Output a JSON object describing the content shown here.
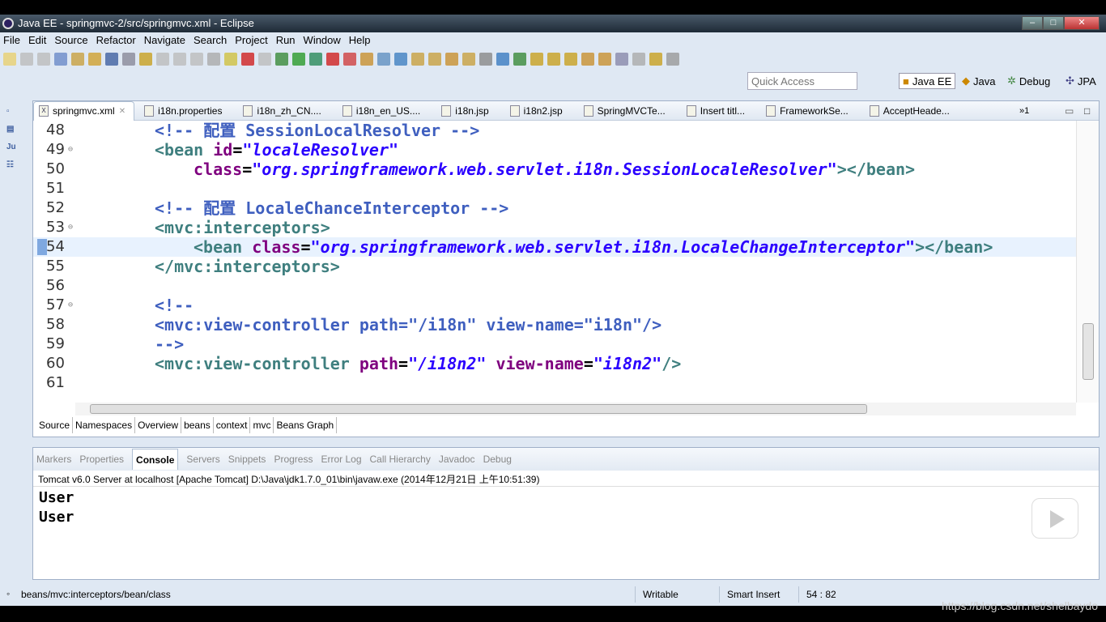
{
  "window": {
    "title": "Java EE - springmvc-2/src/springmvc.xml - Eclipse",
    "min": "–",
    "max": "□",
    "close": "✕"
  },
  "menu": [
    "File",
    "Edit",
    "Source",
    "Refactor",
    "Navigate",
    "Search",
    "Project",
    "Run",
    "Window",
    "Help"
  ],
  "quick_access": {
    "placeholder": "Quick Access"
  },
  "perspectives": [
    "Java EE",
    "Java",
    "Debug",
    "JPA"
  ],
  "left_icons": [
    "restore",
    "package",
    "Ju",
    "outline"
  ],
  "editor_tabs": [
    {
      "label": "springmvc.xml",
      "active": true,
      "icon": "X"
    },
    {
      "label": "i18n.properties"
    },
    {
      "label": "i18n_zh_CN...."
    },
    {
      "label": "i18n_en_US...."
    },
    {
      "label": "i18n.jsp"
    },
    {
      "label": "i18n2.jsp"
    },
    {
      "label": "SpringMVCTe..."
    },
    {
      "label": "Insert titl..."
    },
    {
      "label": "FrameworkSe..."
    },
    {
      "label": "AcceptHeade..."
    }
  ],
  "overflow_tabs": "»1",
  "code": [
    {
      "n": "48",
      "seg": [
        [
          "c",
          "<!-- 配置 SessionLocalResolver -->"
        ]
      ],
      "indent": 4
    },
    {
      "n": "49",
      "fold": true,
      "seg": [
        [
          "t",
          "<bean "
        ],
        [
          "a",
          "id"
        ],
        [
          "p",
          "="
        ],
        [
          "v",
          "\"localeResolver\""
        ]
      ],
      "indent": 4
    },
    {
      "n": "50",
      "seg": [
        [
          "a",
          "class"
        ],
        [
          "p",
          "="
        ],
        [
          "v",
          "\"org.springframework.web.servlet.i18n.SessionLocaleResolver\""
        ],
        [
          "t",
          "></bean>"
        ]
      ],
      "indent": 8
    },
    {
      "n": "51",
      "seg": [],
      "indent": 0
    },
    {
      "n": "52",
      "seg": [
        [
          "c",
          "<!-- 配置 LocaleChanceInterceptor -->"
        ]
      ],
      "indent": 4
    },
    {
      "n": "53",
      "fold": true,
      "seg": [
        [
          "t",
          "<mvc:interceptors>"
        ]
      ],
      "indent": 4
    },
    {
      "n": "54",
      "current": true,
      "seg": [
        [
          "t",
          "<bean "
        ],
        [
          "a",
          "class"
        ],
        [
          "p",
          "="
        ],
        [
          "v",
          "\"org.springframework.web.servlet.i18n.LocaleChangeInterceptor\""
        ],
        [
          "t",
          "></bean>"
        ]
      ],
      "indent": 8
    },
    {
      "n": "55",
      "seg": [
        [
          "t",
          "</mvc:interceptors>"
        ]
      ],
      "indent": 4
    },
    {
      "n": "56",
      "seg": [],
      "indent": 0
    },
    {
      "n": "57",
      "fold": true,
      "seg": [
        [
          "c",
          "<!--"
        ]
      ],
      "indent": 4
    },
    {
      "n": "58",
      "seg": [
        [
          "c",
          "<mvc:view-controller path=\"/i18n\" view-name=\"i18n\"/>"
        ]
      ],
      "indent": 4
    },
    {
      "n": "59",
      "seg": [
        [
          "c",
          "-->"
        ]
      ],
      "indent": 4
    },
    {
      "n": "60",
      "seg": [
        [
          "t",
          "<mvc:view-controller "
        ],
        [
          "a",
          "path"
        ],
        [
          "p",
          "="
        ],
        [
          "v",
          "\"/i18n2\""
        ],
        [
          "p",
          " "
        ],
        [
          "a",
          "view-name"
        ],
        [
          "p",
          "="
        ],
        [
          "v",
          "\"i18n2\""
        ],
        [
          "t",
          "/>"
        ]
      ],
      "indent": 4
    },
    {
      "n": "61",
      "seg": [],
      "indent": 0
    }
  ],
  "editor_bottom_tabs": [
    "Source",
    "Namespaces",
    "Overview",
    "beans",
    "context",
    "mvc",
    "Beans Graph"
  ],
  "console_tabs": [
    "Markers",
    "Properties",
    "Console",
    "Servers",
    "Snippets",
    "Progress",
    "Error Log",
    "Call Hierarchy",
    "Javadoc",
    "Debug"
  ],
  "console": {
    "info": "Tomcat v6.0 Server at localhost [Apache Tomcat] D:\\Java\\jdk1.7.0_01\\bin\\javaw.exe (2014年12月21日 上午10:51:39)",
    "output": [
      "User",
      "User"
    ]
  },
  "status": {
    "path": "beans/mvc:interceptors/bean/class",
    "writable": "Writable",
    "insert": "Smart Insert",
    "position": "54 : 82"
  },
  "watermark": "https://blog.csdn.net/shelbaydo",
  "colors": {
    "comment": "#3f5fbf",
    "tag": "#3f7f7f",
    "attr": "#7f007f",
    "value": "#2a00ff"
  }
}
